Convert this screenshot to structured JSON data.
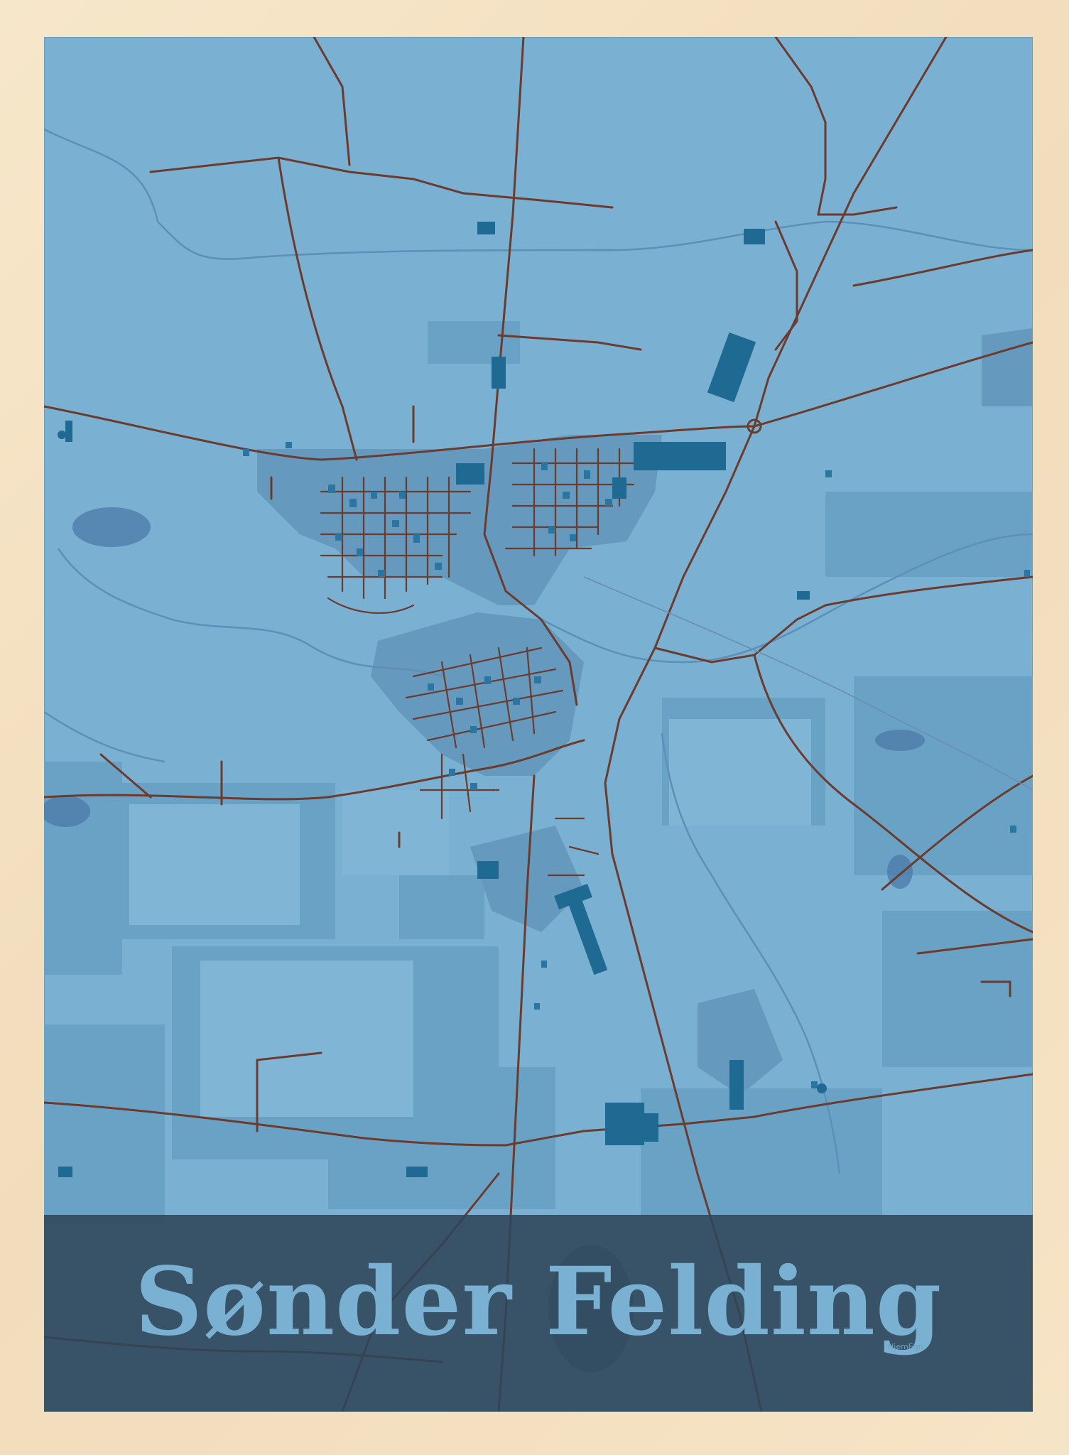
{
  "poster": {
    "title": "Sønder Felding",
    "brand": "HjemEgn"
  },
  "colors": {
    "frame": "#f3e1c4",
    "land": "#7ab0d1",
    "fields": "#6aa2c6",
    "urban": "#6599bd",
    "buildings": "#1f6a93",
    "roads": "#6b3b2e",
    "water": "#4c79a8",
    "title_band": "#2f4658",
    "title_text": "#7ab0d1"
  },
  "map_icons": [
    "roundabout-icon",
    "water-tower-icon"
  ]
}
